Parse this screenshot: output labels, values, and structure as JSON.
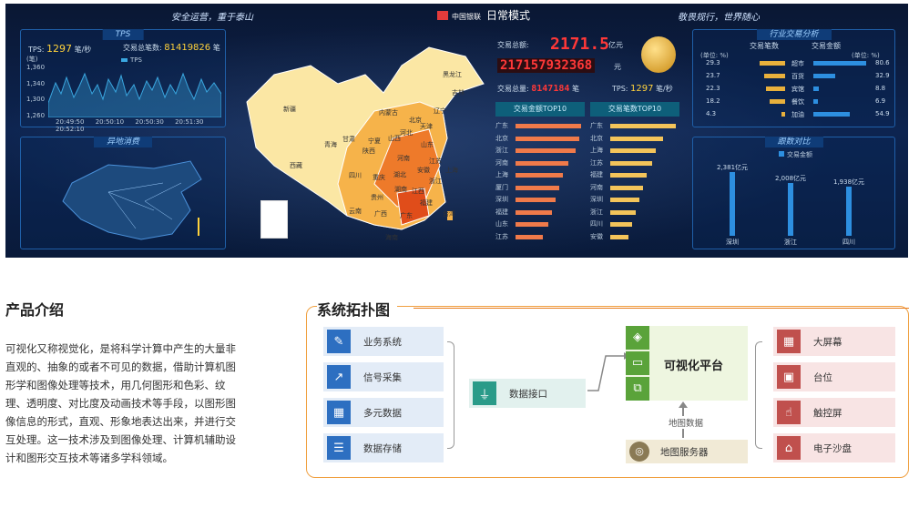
{
  "hero": {
    "slogan_left": "安全运营，重于泰山",
    "mode_title": "日常模式",
    "logo_text": "中国银联",
    "slogan_right": "敬畏规行，世界随心"
  },
  "tps_panel": {
    "title": "TPS",
    "tps_label": "TPS:",
    "tps_value": "1297",
    "tps_unit": "笔/秒",
    "total_label": "交易总笔数:",
    "total_value": "81419826",
    "total_unit": "笔",
    "y_unit": "(笔)",
    "legend": "TPS",
    "yticks": [
      "1,360",
      "1,340",
      "1,300",
      "1,260"
    ],
    "xticks": [
      "20:49:50",
      "20:50:10",
      "20:50:30",
      "20:51:30",
      "20:52:10"
    ]
  },
  "remote_panel": {
    "title": "异地消费"
  },
  "map_labels": [
    "黑龙江",
    "吉林",
    "辽宁",
    "北京",
    "天津",
    "河北",
    "山西",
    "内蒙古",
    "新疆",
    "西藏",
    "青海",
    "甘肃",
    "宁夏",
    "陕西",
    "四川",
    "重庆",
    "湖北",
    "湖南",
    "江西",
    "福建",
    "广东",
    "广西",
    "云南",
    "贵州",
    "海南",
    "台湾",
    "河南",
    "山东",
    "江苏",
    "安徽",
    "浙江",
    "上海"
  ],
  "center": {
    "amount_label": "交易总额:",
    "amount_value": "2171.5",
    "amount_unit": "亿元",
    "amount_full": "217157932368",
    "amount_full_unit": "元",
    "count_label": "交易总量:",
    "count_value": "8147184",
    "count_unit": "笔",
    "tps_label": "TPS:",
    "tps_value": "1297",
    "tps_unit": "笔/秒",
    "tab_amount": "交易金额TOP10",
    "tab_count": "交易笔数TOP10",
    "amount_top": [
      "广东",
      "北京",
      "浙江",
      "河南",
      "上海",
      "厦门",
      "深圳",
      "福建",
      "山东",
      "江苏"
    ],
    "count_top": [
      "广东",
      "北京",
      "上海",
      "江苏",
      "福建",
      "河南",
      "深圳",
      "浙江",
      "四川",
      "安徽"
    ]
  },
  "industry": {
    "title": "行业交易分析",
    "col_count": "交易笔数",
    "col_amount": "交易金额",
    "unit_left": "(单位: %)",
    "unit_right": "(单位: %)",
    "rows": [
      {
        "left": "29.3",
        "name": "超市",
        "right": "80.6"
      },
      {
        "left": "23.7",
        "name": "百货",
        "right": "32.9"
      },
      {
        "left": "22.3",
        "name": "宾馆",
        "right": "8.8"
      },
      {
        "left": "18.2",
        "name": "餐饮",
        "right": "6.9"
      },
      {
        "left": "4.3",
        "name": "加油",
        "right": "54.9"
      }
    ]
  },
  "compare": {
    "title": "跟数对比",
    "legend": "交易金额",
    "bars": [
      {
        "label": "深圳",
        "value": "2,381亿元"
      },
      {
        "label": "浙江",
        "value": "2,008亿元"
      },
      {
        "label": "四川",
        "value": "1,938亿元"
      }
    ]
  },
  "intro": {
    "title": "产品介绍",
    "text": "可视化又称视觉化，是将科学计算中产生的大量非直观的、抽象的或者不可见的数据，借助计算机图形学和图像处理等技术，用几何图形和色彩、纹理、透明度、对比度及动画技术等手段，以图形图像信息的形式，直观、形象地表达出来，并进行交互处理。这一技术涉及到图像处理、计算机辅助设计和图形交互技术等诸多学科领域。"
  },
  "topology": {
    "title": "系统拓扑图",
    "sources": [
      "业务系统",
      "信号采集",
      "多元数据",
      "数据存储"
    ],
    "interface": "数据接口",
    "platform": "可视化平台",
    "map_data": "地图数据",
    "map_service": "地图服务器",
    "outputs": [
      "大屏幕",
      "台位",
      "触控屏",
      "电子沙盘"
    ]
  }
}
